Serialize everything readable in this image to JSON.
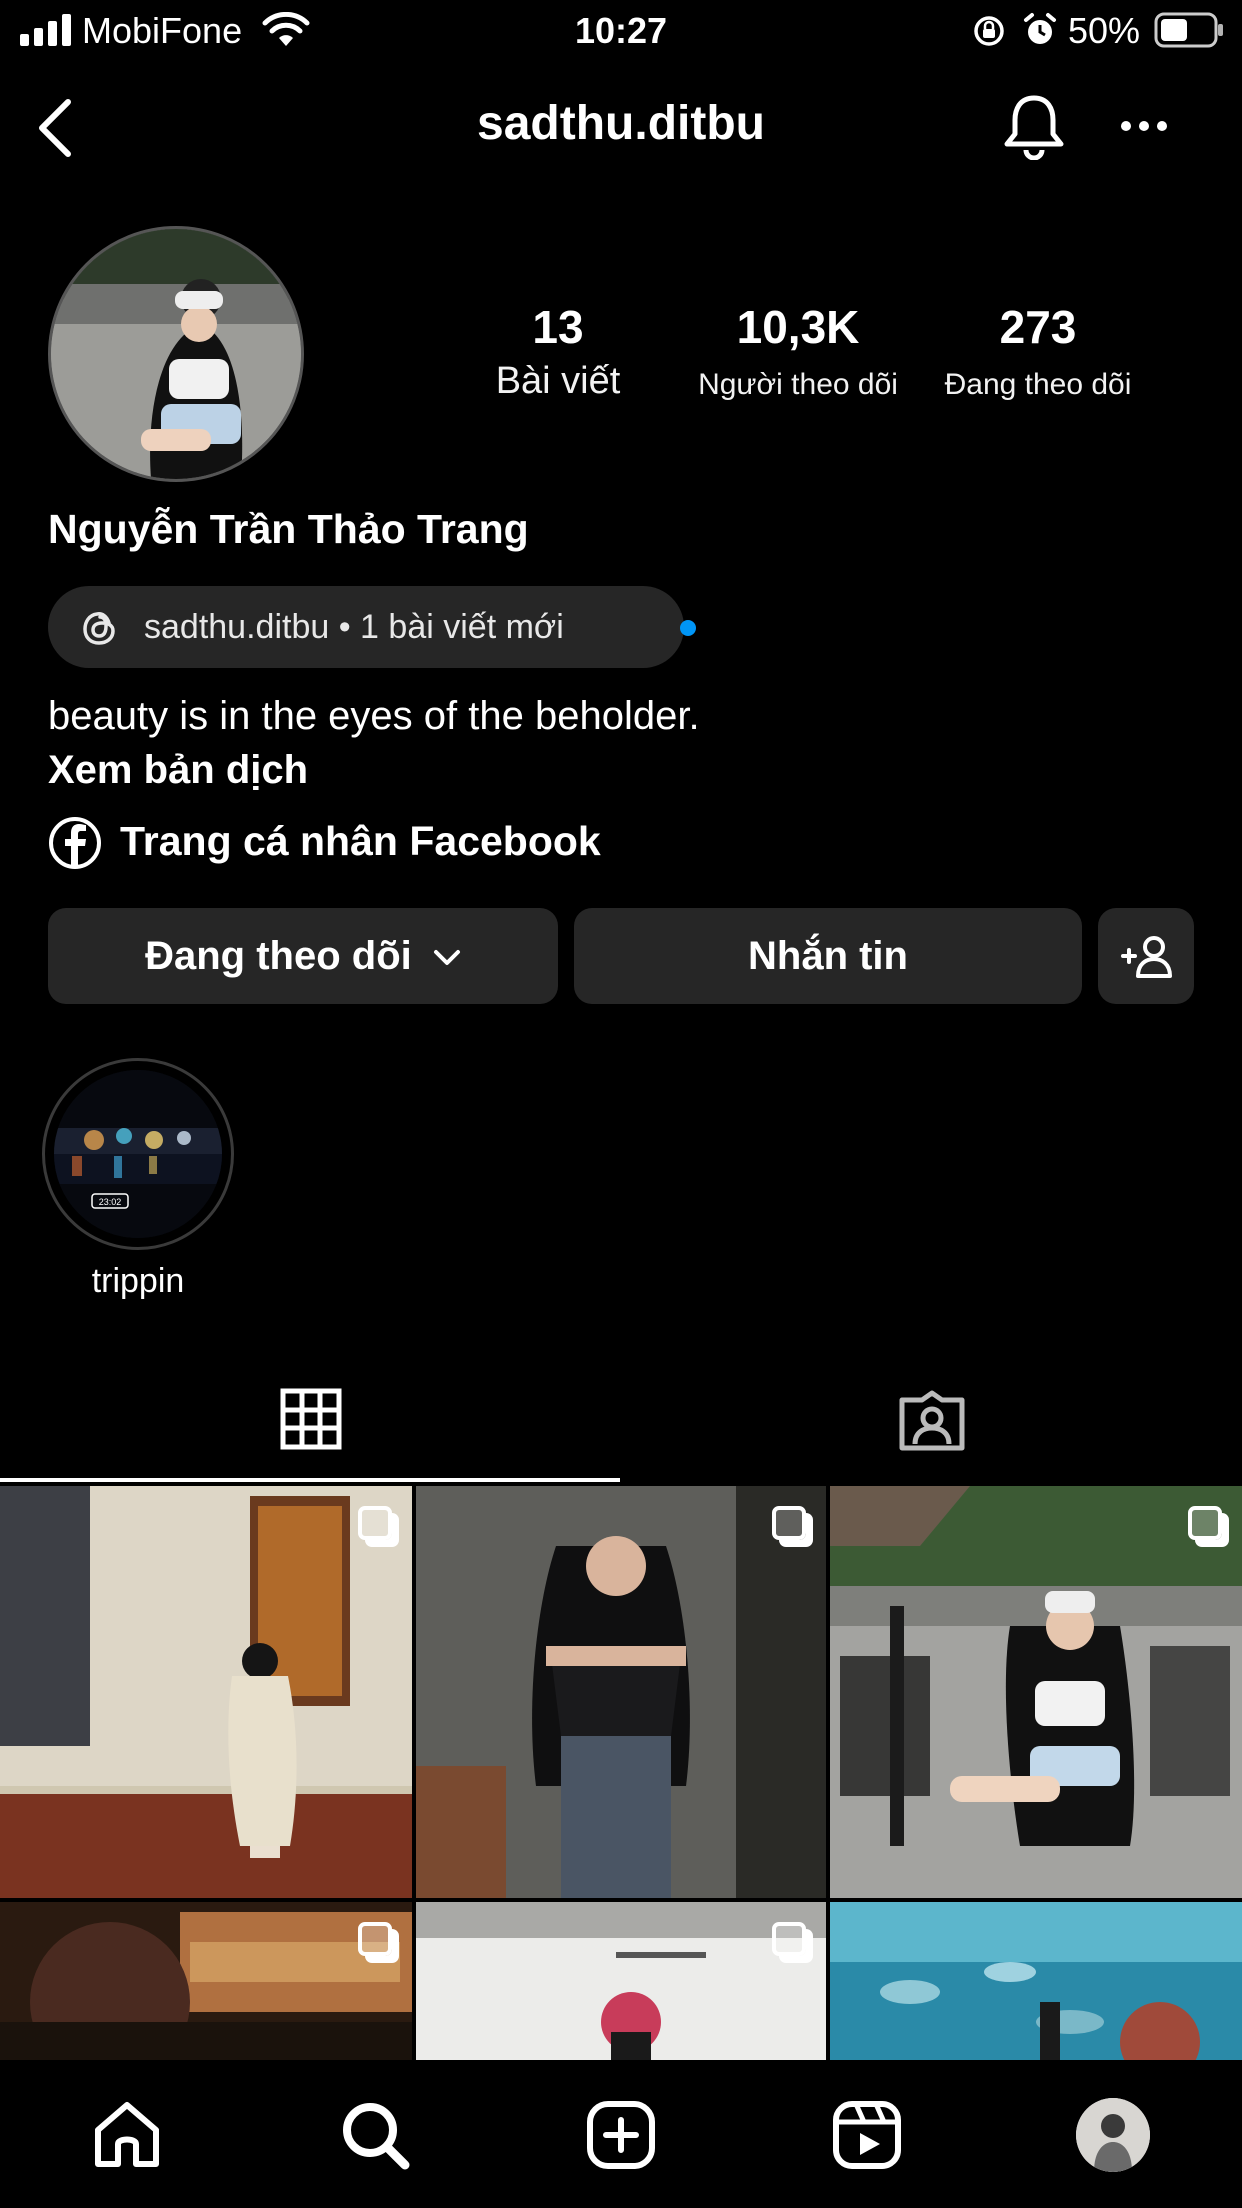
{
  "status_bar": {
    "carrier": "MobiFone",
    "time": "10:27",
    "battery": "50%"
  },
  "header": {
    "username": "sadthu.ditbu",
    "icons": [
      "back-chevron-icon",
      "bell-icon",
      "more-dots-icon"
    ]
  },
  "profile": {
    "stats": [
      {
        "value": "13",
        "label": "Bài viết"
      },
      {
        "value": "10,3K",
        "label": "Người theo dõi"
      },
      {
        "value": "273",
        "label": "Đang theo dõi"
      }
    ],
    "display_name": "Nguyễn Trần Thảo Trang",
    "threads_badge": "sadthu.ditbu • 1 bài viết mới",
    "bio": "beauty is in the eyes of the beholder.",
    "translate_link": "Xem bản dịch",
    "facebook_link": "Trang cá nhân Facebook"
  },
  "actions": {
    "following_label": "Đang theo dõi",
    "message_label": "Nhắn tin"
  },
  "highlights": [
    {
      "label": "trippin",
      "stamp": "23:02"
    }
  ],
  "tabs": [
    "grid-icon",
    "tagged-icon"
  ],
  "colors": {
    "background": "#000000",
    "button_bg": "#262626",
    "accent_blue": "#0095f6"
  },
  "bottom_nav": [
    "home-icon",
    "search-icon",
    "create-icon",
    "reels-icon",
    "profile-avatar"
  ]
}
